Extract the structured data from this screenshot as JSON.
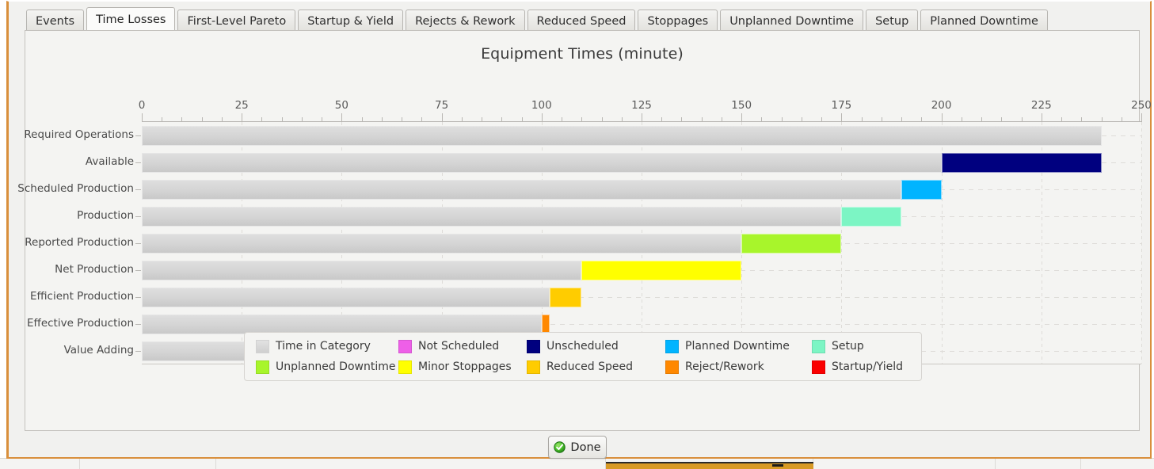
{
  "window": {
    "tabs": [
      {
        "label": "Events",
        "active": false
      },
      {
        "label": "Time Losses",
        "active": true
      },
      {
        "label": "First-Level Pareto",
        "active": false
      },
      {
        "label": "Startup & Yield",
        "active": false
      },
      {
        "label": "Rejects & Rework",
        "active": false
      },
      {
        "label": "Reduced Speed",
        "active": false
      },
      {
        "label": "Stoppages",
        "active": false
      },
      {
        "label": "Unplanned Downtime",
        "active": false
      },
      {
        "label": "Setup",
        "active": false
      },
      {
        "label": "Planned Downtime",
        "active": false
      }
    ]
  },
  "footer": {
    "done_label": "Done",
    "done_icon": "green-check-circle-icon"
  },
  "colors": {
    "time_in_category": "#d6d6d6",
    "not_scheduled": "#ee5fe8",
    "unscheduled": "#00007f",
    "planned_downtime": "#00b4ff",
    "setup": "#7cf5c4",
    "unplanned_downtime": "#a8f52b",
    "minor_stoppages": "#ffff00",
    "reduced_speed": "#ffcc00",
    "reject_rework": "#ff8800",
    "startup_yield": "#fa0000",
    "window_border": "#d98f3c"
  },
  "chart_data": {
    "type": "bar",
    "orientation": "horizontal",
    "title": "Equipment Times (minute)",
    "xlabel": "",
    "ylabel": "",
    "xlim": [
      0,
      250
    ],
    "xticks": [
      0,
      25,
      50,
      75,
      100,
      125,
      150,
      175,
      200,
      225,
      250
    ],
    "xtick_labels": [
      "0",
      "25",
      "50",
      "75",
      "100",
      "125",
      "150",
      "175",
      "200",
      "225",
      "250"
    ],
    "minor_tick_step": 5,
    "grid": true,
    "legend_position": "bottom",
    "categories": [
      "Required Operations",
      "Available",
      "Scheduled Production",
      "Production",
      "Reported Production",
      "Net Production",
      "Efficient Production",
      "Effective Production",
      "Value Adding"
    ],
    "values": [
      240,
      200,
      190,
      175,
      150,
      110,
      102,
      100,
      100
    ],
    "rows": [
      {
        "category": "Required Operations",
        "base": 240,
        "loss_start": null,
        "loss_end": null,
        "loss_series": null
      },
      {
        "category": "Available",
        "base": 200,
        "loss_start": 200,
        "loss_end": 240,
        "loss_series": "Unscheduled"
      },
      {
        "category": "Scheduled Production",
        "base": 190,
        "loss_start": 190,
        "loss_end": 200,
        "loss_series": "Planned Downtime"
      },
      {
        "category": "Production",
        "base": 175,
        "loss_start": 175,
        "loss_end": 190,
        "loss_series": "Setup"
      },
      {
        "category": "Reported Production",
        "base": 150,
        "loss_start": 150,
        "loss_end": 175,
        "loss_series": "Unplanned Downtime"
      },
      {
        "category": "Net Production",
        "base": 110,
        "loss_start": 110,
        "loss_end": 150,
        "loss_series": "Minor Stoppages"
      },
      {
        "category": "Efficient Production",
        "base": 102,
        "loss_start": 102,
        "loss_end": 110,
        "loss_series": "Reduced Speed"
      },
      {
        "category": "Effective Production",
        "base": 100,
        "loss_start": 100,
        "loss_end": 102,
        "loss_series": "Reject/Rework"
      },
      {
        "category": "Value Adding",
        "base": 100,
        "loss_start": null,
        "loss_end": null,
        "loss_series": null
      }
    ],
    "series": [
      {
        "name": "Time in Category",
        "color": "#d6d6d6"
      },
      {
        "name": "Not Scheduled",
        "color": "#ee5fe8"
      },
      {
        "name": "Unscheduled",
        "color": "#00007f"
      },
      {
        "name": "Planned Downtime",
        "color": "#00b4ff"
      },
      {
        "name": "Setup",
        "color": "#7cf5c4"
      },
      {
        "name": "Unplanned Downtime",
        "color": "#a8f52b"
      },
      {
        "name": "Minor Stoppages",
        "color": "#ffff00"
      },
      {
        "name": "Reduced Speed",
        "color": "#ffcc00"
      },
      {
        "name": "Reject/Rework",
        "color": "#ff8800"
      },
      {
        "name": "Startup/Yield",
        "color": "#fa0000"
      }
    ],
    "legend": [
      {
        "label": "Time in Category",
        "color": "#d6d6d6"
      },
      {
        "label": "Not Scheduled",
        "color": "#ee5fe8"
      },
      {
        "label": "Unscheduled",
        "color": "#00007f"
      },
      {
        "label": "Planned Downtime",
        "color": "#00b4ff"
      },
      {
        "label": "Setup",
        "color": "#7cf5c4"
      },
      {
        "label": "Unplanned Downtime",
        "color": "#a8f52b"
      },
      {
        "label": "Minor Stoppages",
        "color": "#ffff00"
      },
      {
        "label": "Reduced Speed",
        "color": "#ffcc00"
      },
      {
        "label": "Reject/Rework",
        "color": "#ff8800"
      },
      {
        "label": "Startup/Yield",
        "color": "#fa0000"
      }
    ]
  }
}
